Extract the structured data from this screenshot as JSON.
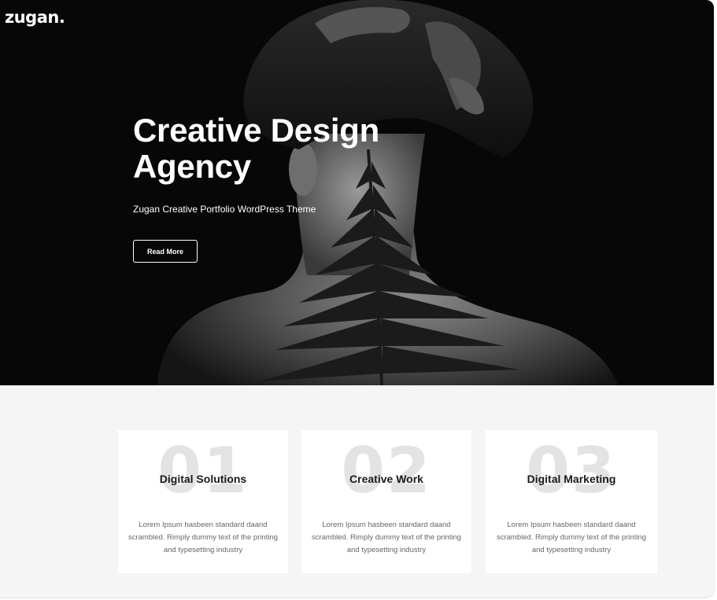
{
  "brand": {
    "logo_text": "zugan."
  },
  "hero": {
    "title_line1": "Creative Design",
    "title_line2": "Agency",
    "subtitle": "Zugan Creative Portfolio WordPress Theme",
    "button_label": "Read More",
    "image_subject": "black-and-white photo of woman's back with fern leaf"
  },
  "features": [
    {
      "number": "01",
      "title": "Digital Solutions",
      "text": "Lorem Ipsum hasbeen standard daand scrambled. Rimply dummy text of the printing and typesetting industry"
    },
    {
      "number": "02",
      "title": "Creative Work",
      "text": "Lorem Ipsum hasbeen standard daand scrambled. Rimply dummy text of the printing and typesetting industry"
    },
    {
      "number": "03",
      "title": "Digital Marketing",
      "text": "Lorem Ipsum hasbeen standard daand scrambled. Rimply dummy text of the printing and typesetting industry"
    }
  ],
  "colors": {
    "hero_bg": "#070707",
    "section_bg": "#f5f5f5",
    "card_bg": "#ffffff",
    "number_watermark": "#e3e3e3",
    "heading": "#1a1a1a",
    "body_text": "#666666"
  }
}
